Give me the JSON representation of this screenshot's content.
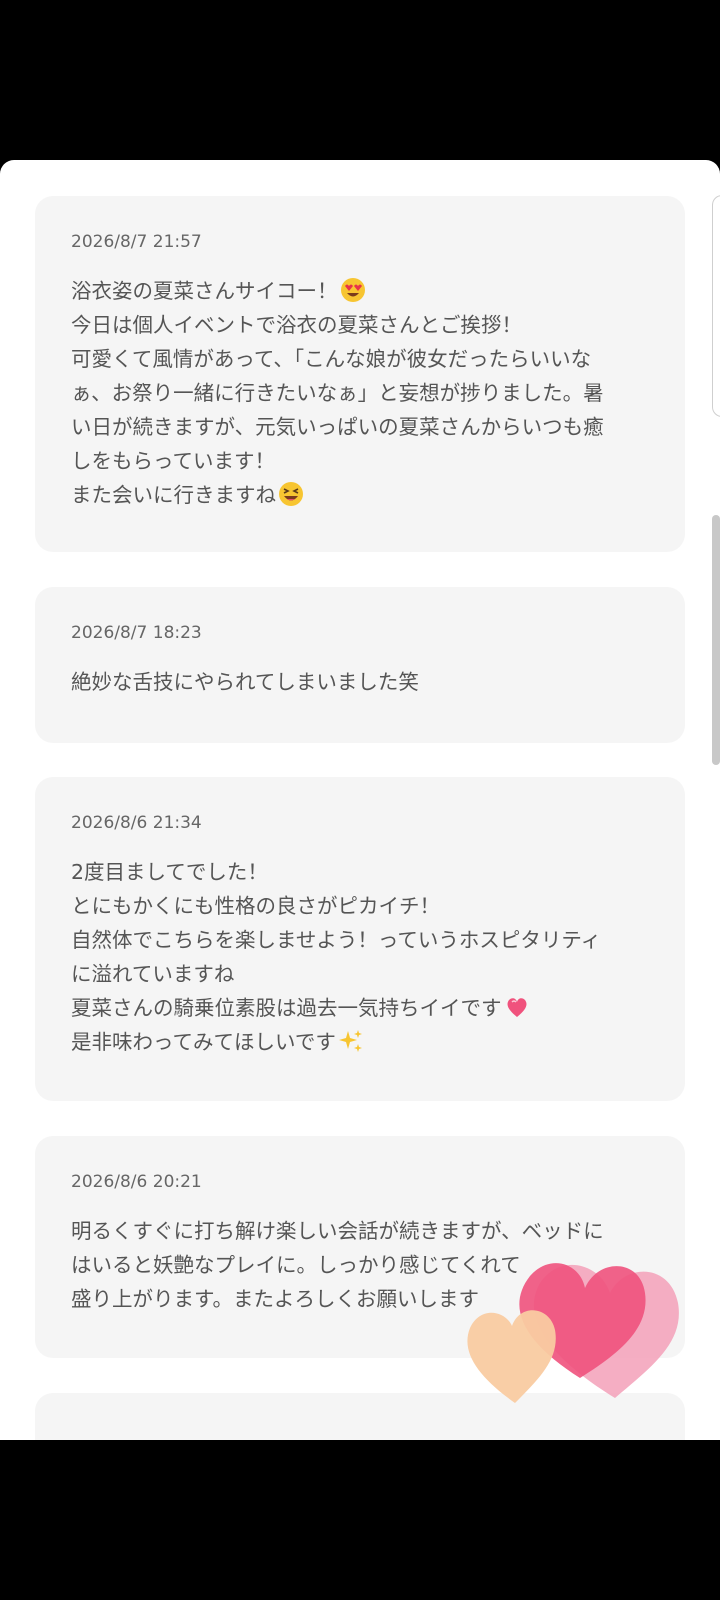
{
  "reviews": [
    {
      "date": "2026/8/7 21:57",
      "lines": [
        "浴衣姿の夏菜さんサイコー！",
        "今日は個人イベントで浴衣の夏菜さんとご挨拶！",
        "可愛くて風情があって、「こんな娘が彼女だったらいいな",
        "ぁ、お祭り一緒に行きたいなぁ」と妄想が捗りました。暑",
        "い日が続きますが、元気いっぱいの夏菜さんからいつも癒",
        "しをもらっています！",
        "また会いに行きますね"
      ],
      "emojis": [
        "heart-eyes-emoji",
        "grinning-squinting-emoji"
      ]
    },
    {
      "date": "2026/8/7 18:23",
      "lines": [
        "絶妙な舌技にやられてしまいました笑"
      ]
    },
    {
      "date": "2026/8/6 21:34",
      "lines": [
        "2度目ましてでした！",
        "とにもかくにも性格の良さがピカイチ！",
        "自然体でこちらを楽しませよう！っていうホスピタリティ",
        "に溢れていますね",
        "夏菜さんの騎乗位素股は過去一気持ちイイです",
        "是非味わってみてほしいです"
      ],
      "emojis": [
        "heart-emoji",
        "sparkles-emoji"
      ]
    },
    {
      "date": "2026/8/6 20:21",
      "lines": [
        "明るくすぐに打ち解け楽しい会話が続きますが、ベッドに",
        "はいると妖艶なプレイに。しっかり感じてくれて",
        "盛り上がります。またよろしくお願いします"
      ]
    }
  ],
  "colors": {
    "card_bg": "#f5f5f5",
    "text": "#555555",
    "date": "#666666",
    "heart_pink": "#f0527d",
    "heart_peach": "#f9cba1"
  }
}
